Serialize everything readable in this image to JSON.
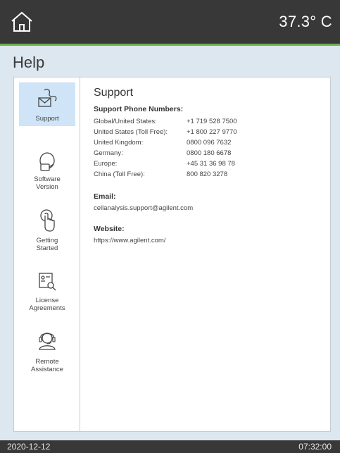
{
  "header": {
    "temperature": "37.3° C",
    "home_icon": "home-icon"
  },
  "page": {
    "title": "Help"
  },
  "sidebar": {
    "items": [
      {
        "label_lines": [
          "Support"
        ],
        "icon": "support-envelope-icon",
        "active": true
      },
      {
        "label_lines": [
          "Software",
          "Version"
        ],
        "icon": "software-version-icon",
        "active": false
      },
      {
        "label_lines": [
          "Getting",
          "Started"
        ],
        "icon": "getting-started-touch-icon",
        "active": false
      },
      {
        "label_lines": [
          "License",
          "Agreements"
        ],
        "icon": "license-agreements-icon",
        "active": false
      },
      {
        "label_lines": [
          "Remote",
          "Assistance"
        ],
        "icon": "remote-assistance-headset-icon",
        "active": false
      }
    ]
  },
  "support": {
    "title": "Support",
    "phone_heading": "Support Phone Numbers:",
    "phones": [
      {
        "region": "Global/United States:",
        "number": "+1 719 528 7500"
      },
      {
        "region": "United States (Toll Free):",
        "number": "+1 800 227 9770"
      },
      {
        "region": "United Kingdom:",
        "number": "0800 096 7632"
      },
      {
        "region": "Germany:",
        "number": "0800 180 6678"
      },
      {
        "region": "Europe:",
        "number": "+45 31 36 98 78"
      },
      {
        "region": "China (Toll Free):",
        "number": "800 820 3278"
      }
    ],
    "email_heading": "Email:",
    "email": "cellanalysis.support@agilent.com",
    "website_heading": "Website:",
    "website": "https://www.agilent.com/"
  },
  "footer": {
    "date": "2020-12-12",
    "time": "07:32:00"
  },
  "colors": {
    "header_bg": "#383838",
    "accent_green": "#6fb14a",
    "page_bg": "#dde7ef",
    "active_item": "#cfe4f6"
  }
}
